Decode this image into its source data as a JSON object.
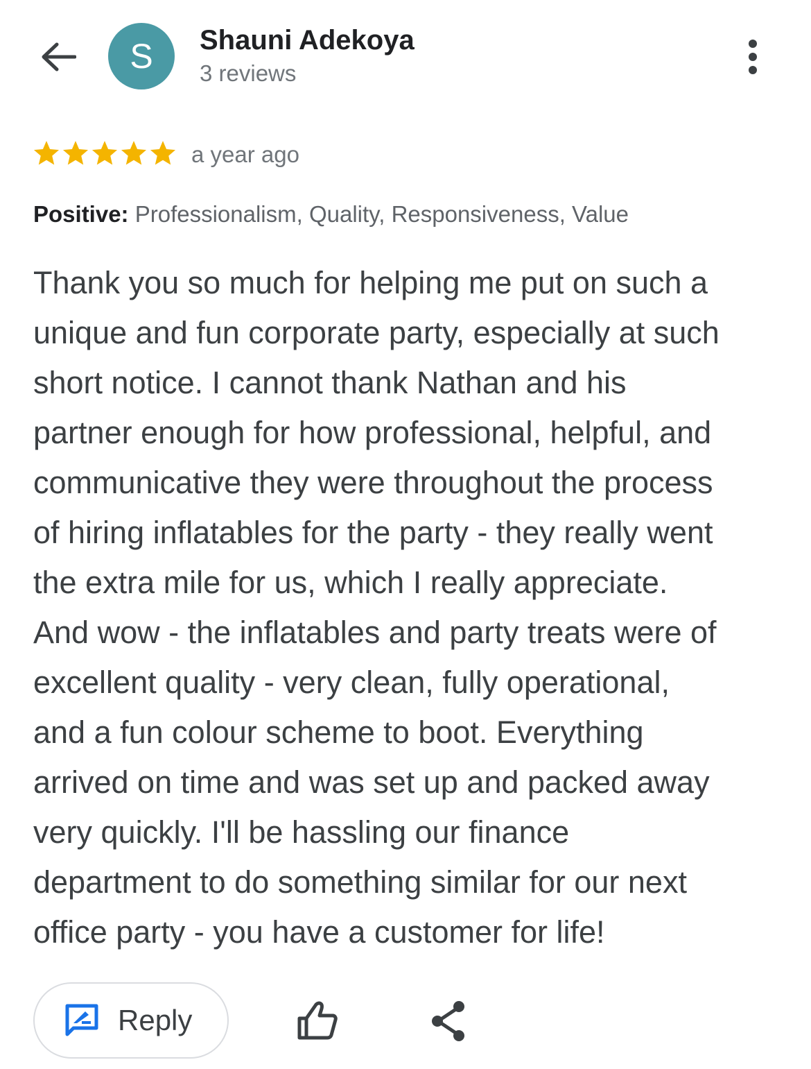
{
  "header": {
    "back_icon": "arrow-back-icon",
    "avatar_letter": "S",
    "avatar_color": "#4a9aa5",
    "reviewer_name": "Shauni Adekoya",
    "review_count": "3 reviews",
    "more_icon": "more-vert-icon"
  },
  "review": {
    "rating": 5,
    "rating_max": 5,
    "star_color": "#f4b400",
    "time": "a year ago",
    "positive_label": "Positive:",
    "positive_values": " Professionalism, Quality, Responsiveness, Value",
    "lines": [
      "Thank you so much for helping me put on such a",
      "unique and fun corporate party, especially at such",
      "short notice. I cannot thank Nathan and his",
      "partner enough for how professional, helpful, and",
      "communicative they were throughout the process",
      "of hiring inflatables for the party - they really went",
      "the extra mile for us, which I really appreciate.",
      "And wow - the inflatables and party treats were of",
      "excellent quality - very clean, fully operational,",
      "and a fun colour scheme to boot. Everything",
      "arrived on time and was set up and packed away",
      "very quickly. I'll be hassling our finance",
      "department to do something similar for our next",
      "office party - you have a customer for life!"
    ]
  },
  "actions": {
    "reply_label": "Reply",
    "reply_icon": "rate-review-icon",
    "like_icon": "thumb-up-icon",
    "share_icon": "share-icon",
    "accent_color": "#1a73e8"
  }
}
